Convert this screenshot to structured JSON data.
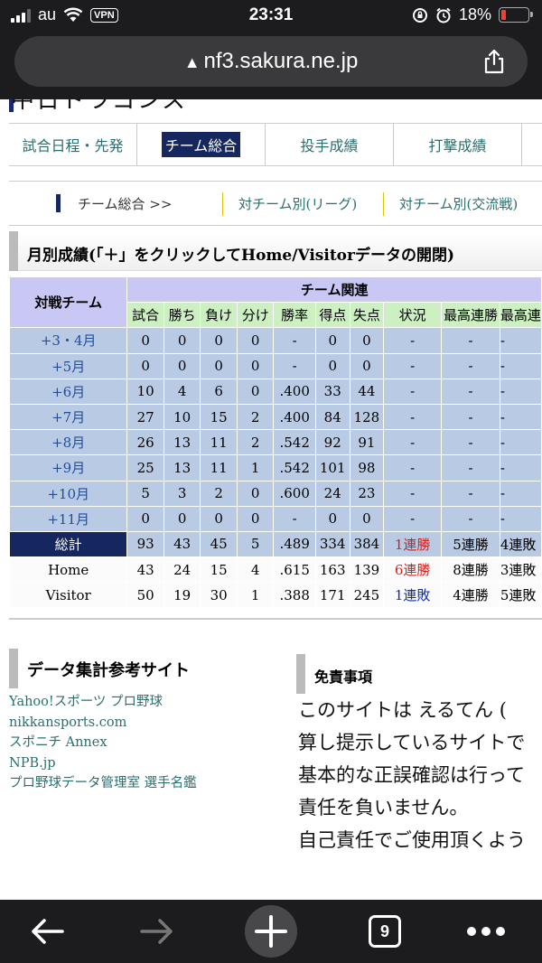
{
  "status_bar": {
    "carrier": "au",
    "vpn": "VPN",
    "time": "23:31",
    "battery": "18%",
    "battery_level": 0.18
  },
  "browser": {
    "url": "nf3.sakura.ne.jp",
    "tab_count": "9"
  },
  "page": {
    "partial_title": "中日ドラゴンズ",
    "nav": [
      "試合日程・先発",
      "チーム総合",
      "投手成績",
      "打撃成績"
    ],
    "subnav": [
      "チーム総合 >>",
      "対チーム別(リーグ)",
      "対チーム別(交流戦)"
    ],
    "section_title": "月別成績(「＋」をクリックしてHome/Visitorデータの開閉)"
  },
  "table": {
    "corner_header": "対戦チーム",
    "group_header": "チーム関連",
    "columns": [
      "試合",
      "勝ち",
      "負け",
      "分け",
      "勝率",
      "得点",
      "失点",
      "状況",
      "最高連勝",
      "最高連"
    ],
    "rows": [
      {
        "label": "+3・4月",
        "cells": [
          "0",
          "0",
          "0",
          "0",
          "-",
          "0",
          "0",
          "-",
          "-",
          "-"
        ]
      },
      {
        "label": "+5月",
        "cells": [
          "0",
          "0",
          "0",
          "0",
          "-",
          "0",
          "0",
          "-",
          "-",
          "-"
        ]
      },
      {
        "label": "+6月",
        "cells": [
          "10",
          "4",
          "6",
          "0",
          ".400",
          "33",
          "44",
          "-",
          "-",
          "-"
        ]
      },
      {
        "label": "+7月",
        "cells": [
          "27",
          "10",
          "15",
          "2",
          ".400",
          "84",
          "128",
          "-",
          "-",
          "-"
        ]
      },
      {
        "label": "+8月",
        "cells": [
          "26",
          "13",
          "11",
          "2",
          ".542",
          "92",
          "91",
          "-",
          "-",
          "-"
        ]
      },
      {
        "label": "+9月",
        "cells": [
          "25",
          "13",
          "11",
          "1",
          ".542",
          "101",
          "98",
          "-",
          "-",
          "-"
        ]
      },
      {
        "label": "+10月",
        "cells": [
          "5",
          "3",
          "2",
          "0",
          ".600",
          "24",
          "23",
          "-",
          "-",
          "-"
        ]
      },
      {
        "label": "+11月",
        "cells": [
          "0",
          "0",
          "0",
          "0",
          "-",
          "0",
          "0",
          "-",
          "-",
          "-"
        ]
      }
    ],
    "total": {
      "label": "総計",
      "cells": [
        "93",
        "43",
        "45",
        "5",
        ".489",
        "334",
        "384",
        "1連勝",
        "5連勝",
        "4連敗"
      ]
    },
    "home": {
      "label": "Home",
      "cells": [
        "43",
        "24",
        "15",
        "4",
        ".615",
        "163",
        "139",
        "6連勝",
        "8連勝",
        "3連敗"
      ]
    },
    "visitor": {
      "label": "Visitor",
      "cells": [
        "50",
        "19",
        "30",
        "1",
        ".388",
        "171",
        "245",
        "1連敗",
        "4連勝",
        "5連敗"
      ]
    }
  },
  "references": {
    "title": "データ集計参考サイト",
    "links": [
      "Yahoo!スポーツ プロ野球",
      "nikkansports.com",
      "スポニチ Annex",
      "NPB.jp",
      "プロ野球データ管理室 選手名鑑"
    ]
  },
  "disclaimer": {
    "title": "免責事項",
    "lines": [
      "このサイトは えるてん (",
      "算し提示しているサイトで",
      "基本的な正誤確認は行って",
      "責任を負いません。",
      "自己責任でご使用頂くよう"
    ]
  },
  "colors": {
    "navy": "#15275e",
    "link": "#2b6e6e",
    "row_blue": "#b8cae4",
    "header_lavender": "#c9c8f5",
    "header_green": "#cdf0c3",
    "win_red": "#d42020",
    "loss_blue": "#1030b0"
  }
}
